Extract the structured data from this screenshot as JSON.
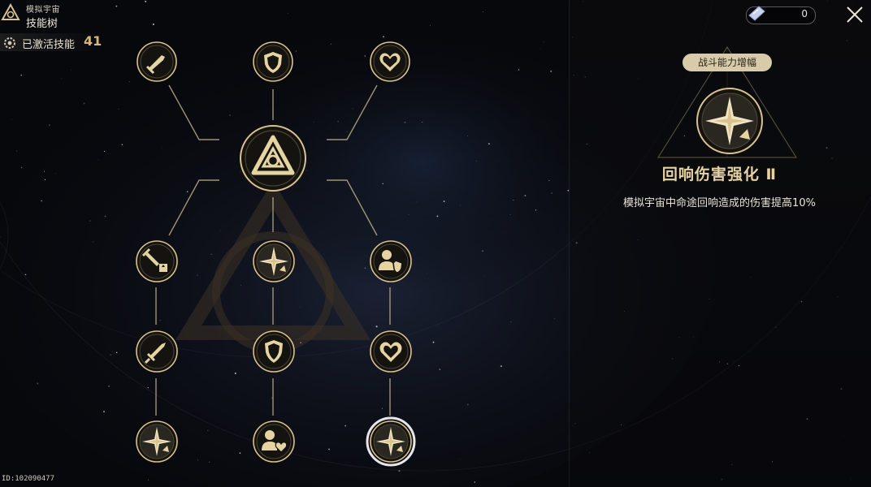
{
  "header": {
    "mode_label": "模拟宇宙",
    "page_title": "技能树",
    "activated_label": "已激活技能",
    "activated_count": "41"
  },
  "currency": {
    "amount": "0"
  },
  "detail": {
    "category": "战斗能力增幅",
    "skill_name": "回响伤害强化 Ⅱ",
    "description": "模拟宇宙中命途回响造成的伤害提高10%"
  },
  "footer": {
    "uid": "ID:102090477"
  },
  "colors": {
    "gold": "#d8c28e",
    "node_fill": "#14130f",
    "badge": "#d7cba9",
    "title_gold": "#e6d3a2"
  },
  "nodes": [
    {
      "id": "sword-top",
      "icon": "sword-icon"
    },
    {
      "id": "shield-top",
      "icon": "shield-icon"
    },
    {
      "id": "heart-top",
      "icon": "heart-icon"
    },
    {
      "id": "center-emblem",
      "icon": "triangle-emblem-icon"
    },
    {
      "id": "sword-upgrade-1",
      "icon": "sword-upgrade-icon"
    },
    {
      "id": "echo-star-1",
      "icon": "compass-star-icon"
    },
    {
      "id": "person-shield-1",
      "icon": "person-shield-icon"
    },
    {
      "id": "sword-2",
      "icon": "sword-icon"
    },
    {
      "id": "shield-2",
      "icon": "shield-icon"
    },
    {
      "id": "heart-2",
      "icon": "heart-icon"
    },
    {
      "id": "echo-star-2",
      "icon": "compass-star-icon"
    },
    {
      "id": "person-heart-1",
      "icon": "person-heart-icon"
    },
    {
      "id": "echo-star-selected",
      "icon": "compass-star-icon",
      "selected": true
    }
  ]
}
